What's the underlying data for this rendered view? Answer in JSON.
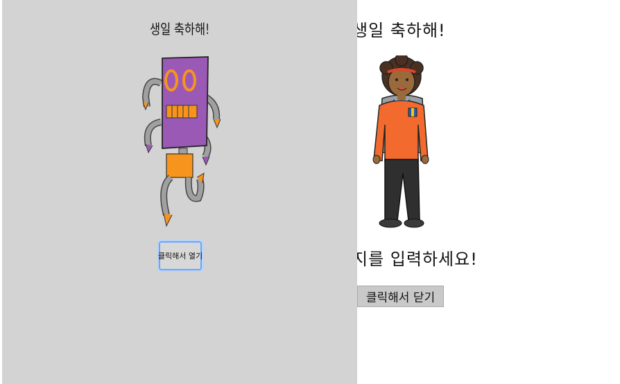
{
  "back": {
    "title": "생일  축하해!",
    "message": "지를  입력하세요!",
    "close_label": "클릭해서 닫기",
    "illustration": "kid-with-backpack"
  },
  "front": {
    "title": "생일 축하해!",
    "open_label": "클릭해서 열기",
    "illustration": "robot"
  },
  "colors": {
    "front_bg": "#d3d3d3",
    "robot_body": "#9b59b6",
    "accent_orange": "#f7941d",
    "focus_ring": "#6aa6f7"
  }
}
